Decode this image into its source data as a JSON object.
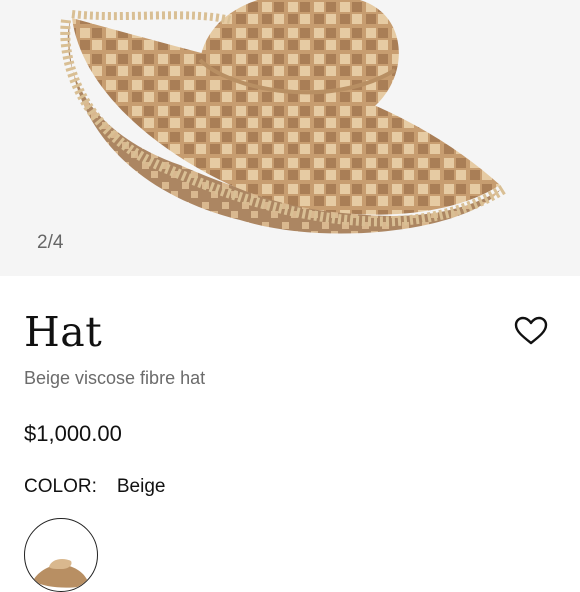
{
  "gallery": {
    "counter": "2/4",
    "current": 2,
    "total": 4
  },
  "product": {
    "title": "Hat",
    "subtitle": "Beige viscose fibre hat",
    "price": "$1,000.00",
    "color_label": "COLOR:",
    "color_value": "Beige"
  },
  "icons": {
    "favorite": "heart-outline-icon"
  },
  "colors": {
    "accent": "#111111",
    "muted": "#6b6b6b",
    "hat_light": "#d9b88e",
    "hat_dark": "#9a7250"
  }
}
